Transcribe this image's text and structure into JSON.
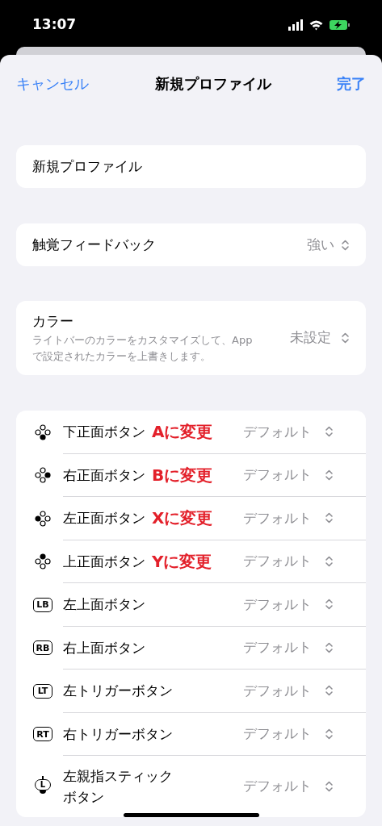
{
  "status_bar": {
    "time": "13:07"
  },
  "nav": {
    "cancel": "キャンセル",
    "title": "新規プロファイル",
    "done": "完了"
  },
  "name_field": {
    "value": "新規プロファイル"
  },
  "haptics": {
    "label": "触覚フィードバック",
    "value": "強い"
  },
  "color": {
    "label": "カラー",
    "description": "ライトバーのカラーをカスタマイズして、Appで設定されたカラーを上書きします。",
    "value": "未設定"
  },
  "buttons": [
    {
      "kind": "face",
      "dots": {
        "top": false,
        "right": false,
        "bottom": true,
        "left": false
      },
      "label": "下正面ボタン",
      "annotation": "Aに変更",
      "value": "デフォルト"
    },
    {
      "kind": "face",
      "dots": {
        "top": false,
        "right": true,
        "bottom": false,
        "left": false
      },
      "label": "右正面ボタン",
      "annotation": "Bに変更",
      "value": "デフォルト"
    },
    {
      "kind": "face",
      "dots": {
        "top": false,
        "right": false,
        "bottom": false,
        "left": true
      },
      "label": "左正面ボタン",
      "annotation": "Xに変更",
      "value": "デフォルト"
    },
    {
      "kind": "face",
      "dots": {
        "top": true,
        "right": false,
        "bottom": false,
        "left": false
      },
      "label": "上正面ボタン",
      "annotation": "Yに変更",
      "value": "デフォルト"
    },
    {
      "kind": "badge",
      "icon_text": "LB",
      "label": "左上面ボタン",
      "value": "デフォルト"
    },
    {
      "kind": "badge",
      "icon_text": "RB",
      "label": "右上面ボタン",
      "value": "デフォルト"
    },
    {
      "kind": "badge",
      "icon_text": "LT",
      "label": "左トリガーボタン",
      "value": "デフォルト"
    },
    {
      "kind": "badge",
      "icon_text": "RT",
      "label": "右トリガーボタン",
      "value": "デフォルト"
    },
    {
      "kind": "stick",
      "icon_text": "L",
      "label": "左親指スティックボタン",
      "value": "デフォルト"
    }
  ]
}
